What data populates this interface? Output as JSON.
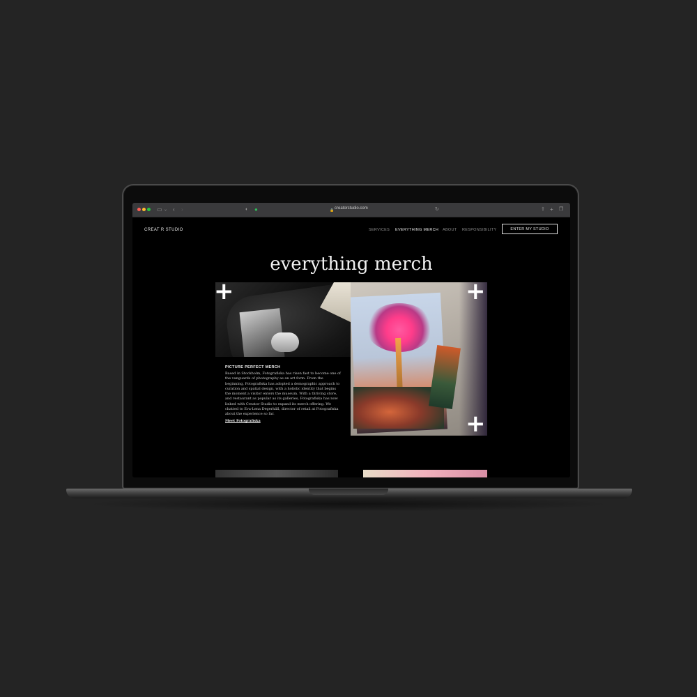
{
  "browser": {
    "url": "creatorstudio.com",
    "traffic_lights": [
      "#ff5f57",
      "#febc2e",
      "#28c840"
    ]
  },
  "site": {
    "logo": "CREAT R STUDIO",
    "nav": {
      "items": [
        "SERVICES",
        "EVERYTHING MERCH",
        "ABOUT",
        "RESPONSIBILITY"
      ],
      "active": "EVERYTHING MERCH",
      "cta": "ENTER MY STUDIO"
    },
    "hero": {
      "title": "everything merch"
    },
    "card": {
      "title": "PICTURE PERFECT MERCH",
      "body": "Based in Stockholm, Fotografiska has risen fast to become one of the vanguards of photography as an art form. From the beginning, Fotografiska has adopted a demographic approach to curation and spatial design, with a holistic identity that begins the moment a visitor enters the museum. With a thriving store, and restaurant as popular as its galleries, Fotografiska has now linked with Creator Studio to expand its merch offering. We chatted to Eva-Lena Degerhäll, director of retail at Fotografiska about the experience so far.",
      "link": "Meet Fotografiska"
    },
    "plus_icon_glyph": "+"
  },
  "colors": {
    "page_bg": "#242424",
    "site_bg": "#000000",
    "text_primary": "#f2f2f2",
    "nav_inactive": "#8c8c8c"
  }
}
